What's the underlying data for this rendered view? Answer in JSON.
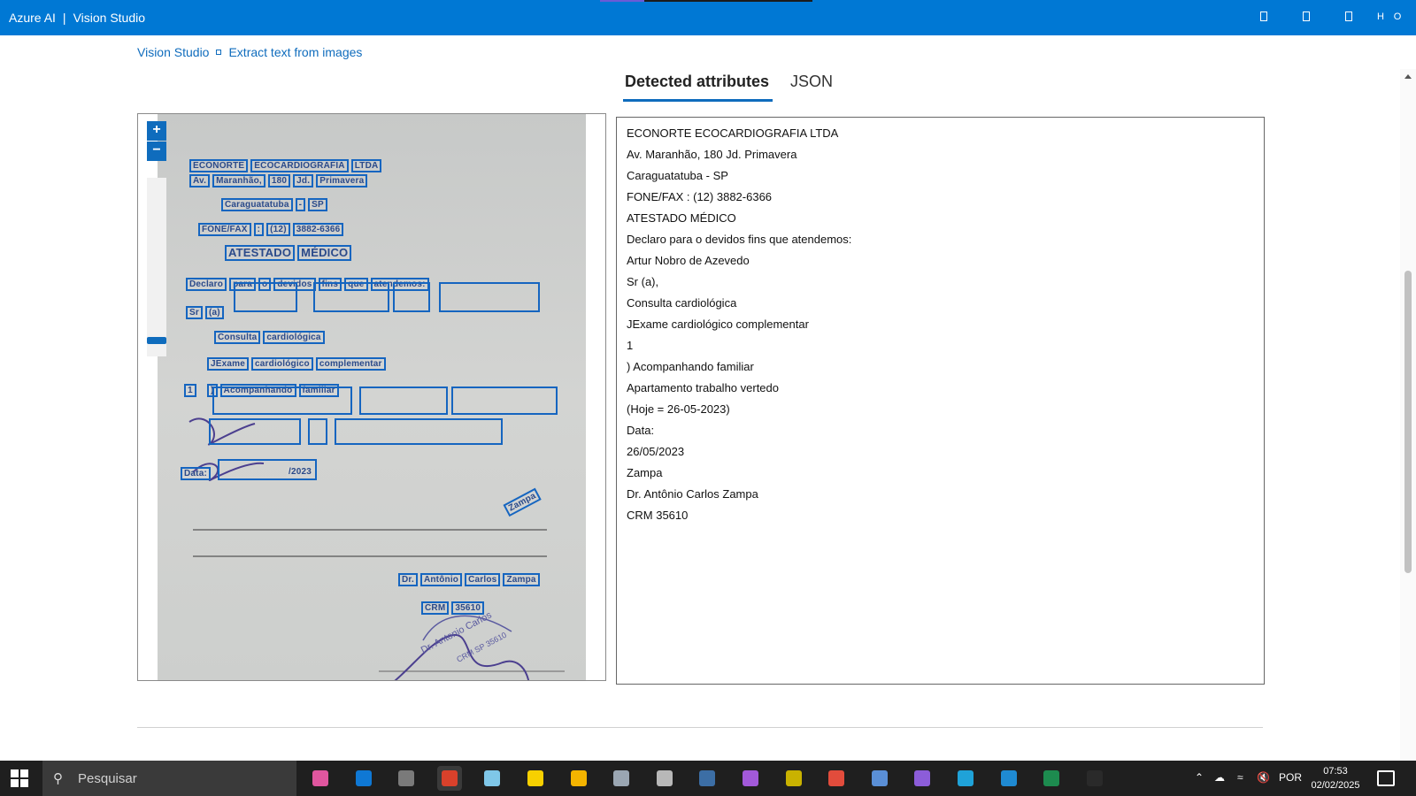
{
  "app": {
    "brand": "Azure AI",
    "product": "Vision Studio"
  },
  "window_controls": [
    "panel-icon",
    "panel-icon",
    "panel-icon",
    "H",
    "O"
  ],
  "breadcrumb": {
    "root": "Vision Studio",
    "current": "Extract text from images"
  },
  "tabs": {
    "detected": "Detected attributes",
    "json": "JSON"
  },
  "zoom": {
    "in": "+",
    "out": "−"
  },
  "document_lines": [
    {
      "words": [
        "ECONORTE",
        "ECOCARDIOGRAFIA",
        "LTDA"
      ]
    },
    {
      "words": [
        "Av.",
        "Maranhão,",
        "180",
        "Jd.",
        "Primavera"
      ]
    },
    {
      "words": [
        "Caraguatatuba",
        "-",
        "SP"
      ]
    },
    {
      "words": [
        "FONE/FAX",
        ":",
        "(12)",
        "3882-6366"
      ]
    },
    {
      "words": [
        "ATESTADO",
        "MÉDICO"
      ]
    },
    {
      "words": [
        "Declaro",
        "para",
        "o",
        "devidos",
        "fins",
        "que",
        "atendemos:"
      ]
    },
    {
      "words": [
        "Sr",
        "(a)"
      ]
    },
    {
      "words": [
        "Consulta",
        "cardiológica"
      ]
    },
    {
      "words": [
        "JExame",
        "cardiológico",
        "complementar"
      ]
    },
    {
      "words": [
        "1"
      ]
    },
    {
      "words": [
        ")",
        "Acompanhando",
        "familiar"
      ]
    },
    {
      "words": [
        "Data:"
      ]
    },
    {
      "words": [
        "/2023"
      ]
    },
    {
      "words": [
        "Zampa"
      ]
    },
    {
      "words": [
        "Dr.",
        "Antônio",
        "Carlos",
        "Zampa"
      ]
    },
    {
      "words": [
        "CRM",
        "35610"
      ]
    }
  ],
  "extracted_text": [
    "ECONORTE ECOCARDIOGRAFIA LTDA",
    "Av. Maranhão, 180 Jd. Primavera",
    "Caraguatatuba - SP",
    "FONE/FAX : (12) 3882-6366",
    "ATESTADO MÉDICO",
    "Declaro para o devidos fins que atendemos:",
    "Artur Nobro de Azevedo",
    "Sr (a),",
    "Consulta cardiológica",
    "JExame cardiológico complementar",
    "1",
    ") Acompanhando familiar",
    "Apartamento trabalho vertedo",
    "(Hoje = 26-05-2023)",
    "Data:",
    "26/05/2023",
    "Zampa",
    "Dr. Antônio Carlos Zampa",
    "CRM 35610"
  ],
  "taskbar": {
    "search_placeholder": "Pesquisar",
    "apps": [
      {
        "name": "copilot-icon",
        "color": "#e0569f"
      },
      {
        "name": "outlook-icon",
        "color": "#0f78d4"
      },
      {
        "name": "calculator-icon",
        "color": "#7a7a7a"
      },
      {
        "name": "snipping-tool-icon",
        "color": "#d9412b",
        "active": true
      },
      {
        "name": "notepad-icon",
        "color": "#7fc7e8"
      },
      {
        "name": "sticky-notes-icon",
        "color": "#f7d000"
      },
      {
        "name": "file-explorer-icon",
        "color": "#f4b400"
      },
      {
        "name": "3d-box-icon",
        "color": "#9aa6b2"
      },
      {
        "name": "database-icon",
        "color": "#b8b8b8"
      },
      {
        "name": "sql-studio-icon",
        "color": "#3c6ea5"
      },
      {
        "name": "visual-studio-icon",
        "color": "#a259d9"
      },
      {
        "name": "power-automate-icon",
        "color": "#c9b200"
      },
      {
        "name": "chrome-icon",
        "color": "#e24c3c"
      },
      {
        "name": "remote-desktop-icon",
        "color": "#5a8fd6"
      },
      {
        "name": "visual-studio-2-icon",
        "color": "#8c5dd9"
      },
      {
        "name": "edge-icon",
        "color": "#1fa2d8"
      },
      {
        "name": "vscode-icon",
        "color": "#1f8ad2"
      },
      {
        "name": "excel-icon",
        "color": "#1d8b4f"
      },
      {
        "name": "terminal-icon",
        "color": "#2a2a2a"
      }
    ],
    "tray": {
      "language": "POR",
      "time": "07:53",
      "date": "02/02/2025"
    }
  }
}
